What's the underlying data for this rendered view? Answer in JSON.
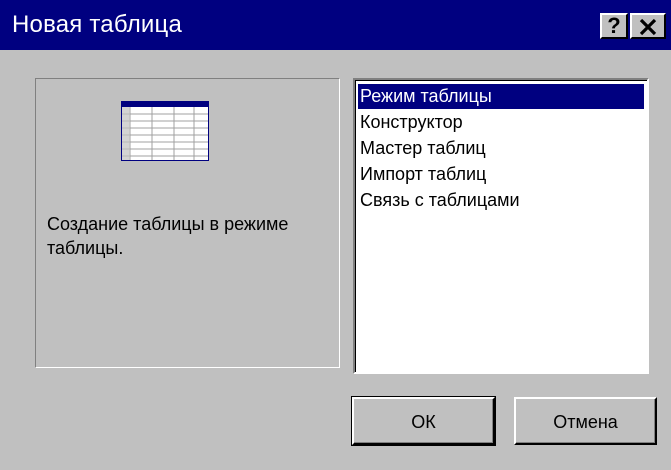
{
  "window": {
    "title": "Новая таблица",
    "help_glyph": "?",
    "close_glyph": "✕"
  },
  "preview": {
    "description": "Создание таблицы в режиме таблицы.",
    "icon": "datasheet-table-icon"
  },
  "list": {
    "items": [
      {
        "label": "Режим таблицы",
        "selected": true
      },
      {
        "label": "Конструктор",
        "selected": false
      },
      {
        "label": "Мастер таблиц",
        "selected": false
      },
      {
        "label": "Импорт таблиц",
        "selected": false
      },
      {
        "label": "Связь с таблицами",
        "selected": false
      }
    ]
  },
  "buttons": {
    "ok_label": "ОК",
    "cancel_label": "Отмена"
  },
  "colors": {
    "titlebar": "#000080",
    "face": "#c0c0c0",
    "selection": "#000080"
  }
}
